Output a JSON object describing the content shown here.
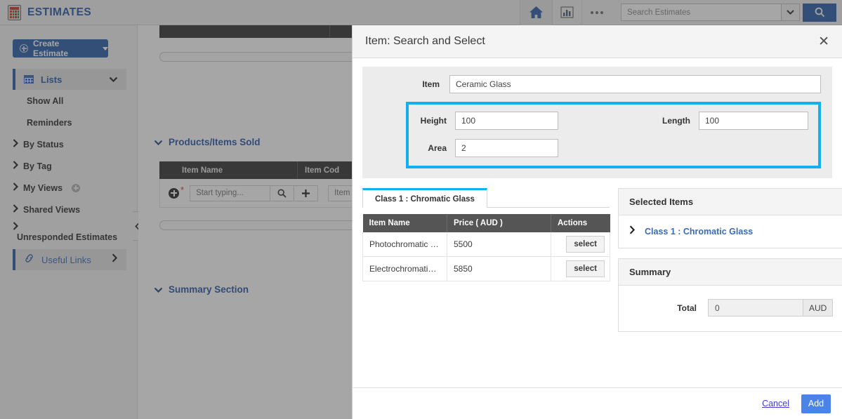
{
  "app": {
    "brand": "ESTIMATES",
    "brand_icon": "calculator-icon",
    "colors": {
      "brand_blue": "#2b5fa8",
      "link_blue": "#3a6bb5",
      "highlight_cyan": "#12b0f0",
      "add_button": "#4a84e8"
    }
  },
  "topbar": {
    "home_icon": "home-icon",
    "reports_icon": "bar-chart-icon",
    "more_icon": "ellipsis-icon",
    "search": {
      "placeholder": "Search Estimates",
      "value": "",
      "caret_icon": "chevron-down-icon",
      "button_icon": "search-icon"
    }
  },
  "sidebar": {
    "create_button": {
      "label": "Create Estimate",
      "icon": "plus-circle-icon",
      "caret": "caret-down-icon"
    },
    "lists": {
      "label": "Lists",
      "icon": "grid-icon",
      "caret": "chevron-down-icon"
    },
    "items": [
      {
        "label": "Show All",
        "icon": ""
      },
      {
        "label": "Reminders",
        "icon": ""
      },
      {
        "label": "By Status",
        "icon": "chevron-right-icon"
      },
      {
        "label": "By Tag",
        "icon": "chevron-right-icon"
      },
      {
        "label": "My Views",
        "icon": "chevron-right-icon",
        "add_icon": "plus-circle-icon"
      },
      {
        "label": "Shared Views",
        "icon": "chevron-right-icon"
      }
    ],
    "unresponded": {
      "label": "Unresponded Estimates",
      "icon": "chevron-right-icon"
    },
    "useful_links": {
      "label": "Useful Links",
      "icon": "link-icon",
      "caret": "chevron-right-icon"
    },
    "collapse_icon": "chevron-left-icon"
  },
  "background": {
    "sections": [
      {
        "label": "Products/Items Sold",
        "caret": "chevron-down-icon"
      },
      {
        "label": "Summary Section",
        "caret": "chevron-down-icon"
      }
    ],
    "table": {
      "headers": [
        "Item Name",
        "Item Cod"
      ],
      "add_icon": "plus-circle-icon",
      "item_name_placeholder": "Start typing...",
      "search_icon": "search-icon",
      "plus_icon": "plus-icon",
      "item_code_placeholder": "Item C"
    }
  },
  "modal": {
    "title": "Item: Search and Select",
    "close_icon": "close-icon",
    "form": {
      "item_label": "Item",
      "item_value": "Ceramic Glass",
      "height_label": "Height",
      "height_value": "100",
      "length_label": "Length",
      "length_value": "100",
      "area_label": "Area",
      "area_value": "2"
    },
    "tabs": [
      {
        "label": "Class 1 : Chromatic Glass",
        "active": true
      }
    ],
    "results": {
      "headers": [
        "Item Name",
        "Price ( AUD )",
        "Actions"
      ],
      "rows": [
        {
          "name": "Photochromatic Glass",
          "price": "5500",
          "action": "select"
        },
        {
          "name": "Electrochromatic Gl...",
          "price": "5850",
          "action": "select"
        }
      ]
    },
    "selected_items": {
      "title": "Selected Items",
      "entries": [
        {
          "label": "Class 1 : Chromatic Glass",
          "caret": "chevron-right-icon"
        }
      ]
    },
    "summary": {
      "title": "Summary",
      "total_label": "Total",
      "total_value": "0",
      "currency": "AUD"
    },
    "footer": {
      "cancel_label": "Cancel",
      "add_label": "Add"
    }
  }
}
